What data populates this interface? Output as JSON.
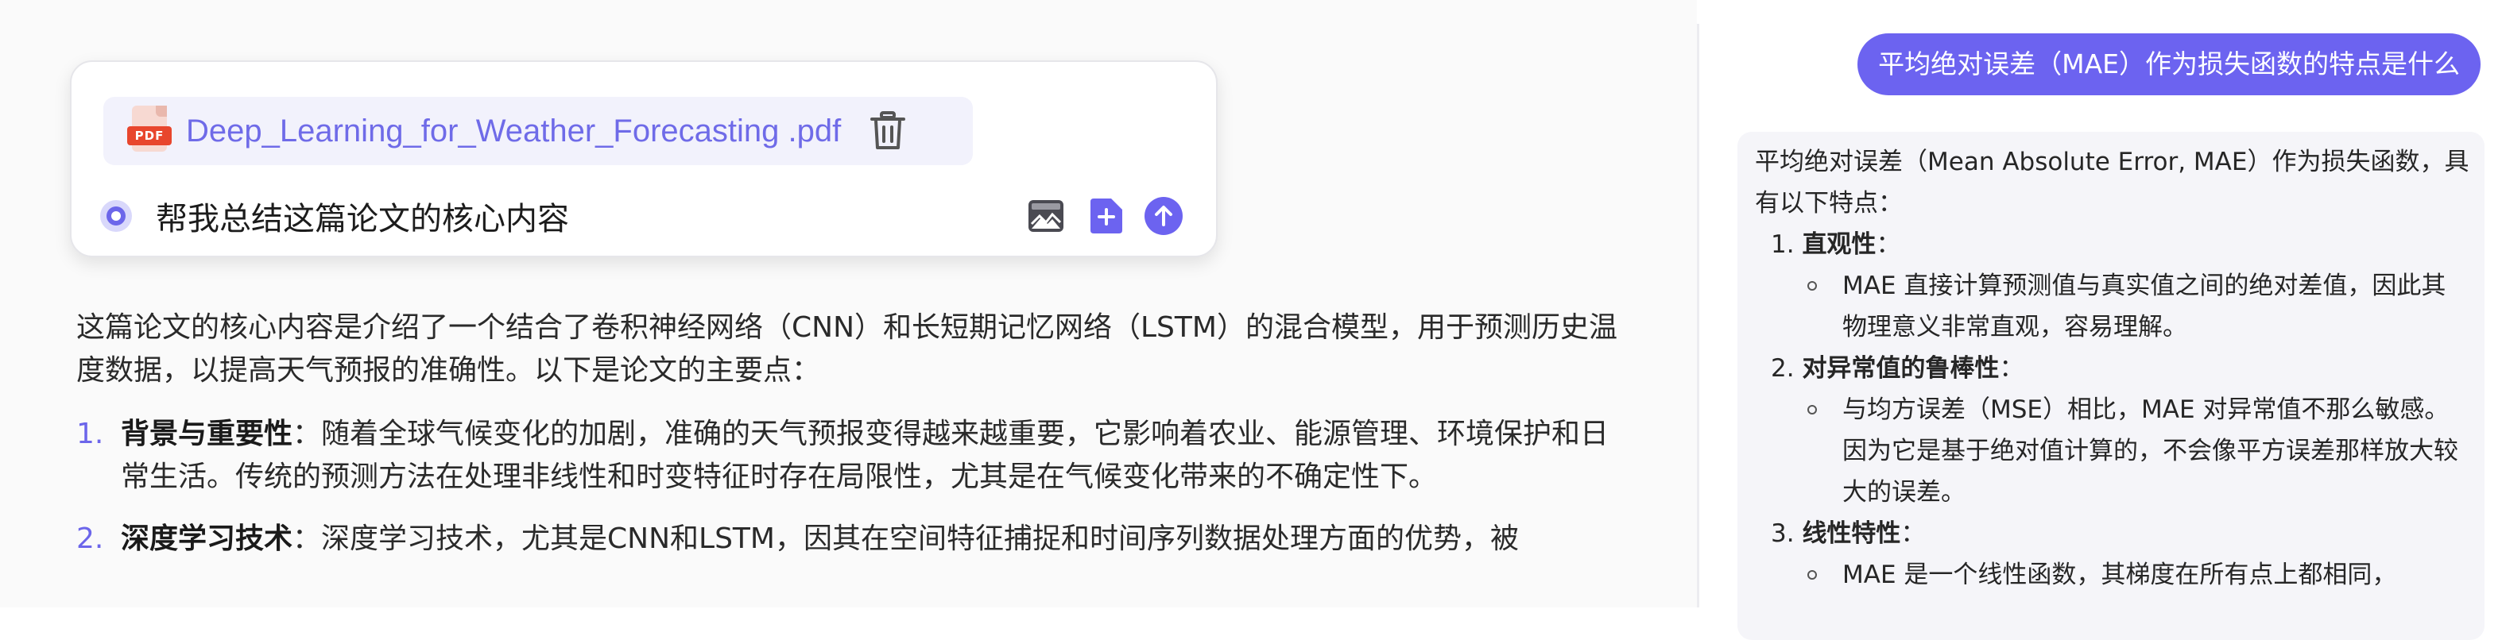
{
  "input_card": {
    "file_name": "Deep_Learning_for_Weather_Forecasting .pdf",
    "pdf_badge": "PDF",
    "prompt": "帮我总结这篇论文的核心内容"
  },
  "answer": {
    "intro": "这篇论文的核心内容是介绍了一个结合了卷积神经网络（CNN）和长短期记忆网络（LSTM）的混合模型，用于预测历史温度数据，以提高天气预报的准确性。以下是论文的主要点：",
    "points": [
      {
        "num": "1.",
        "title": "背景与重要性",
        "text": "：随着全球气候变化的加剧，准确的天气预报变得越来越重要，它影响着农业、能源管理、环境保护和日常生活。传统的预测方法在处理非线性和时变特征时存在局限性，尤其是在气候变化带来的不确定性下。"
      },
      {
        "num": "2.",
        "title": "深度学习技术",
        "text": "：深度学习技术，尤其是CNN和LSTM，因其在空间特征捕捉和时间序列数据处理方面的优势，被"
      }
    ]
  },
  "chat": {
    "user_message": "平均绝对误差（MAE）作为损失函数的特点是什么",
    "reply_intro": "平均绝对误差（Mean Absolute Error, MAE）作为损失函数，具有以下特点：",
    "points": [
      {
        "num": "1.",
        "title": "直观性",
        "colon": "：",
        "sub": "MAE 直接计算预测值与真实值之间的绝对差值，因此其物理意义非常直观，容易理解。"
      },
      {
        "num": "2.",
        "title": "对异常值的鲁棒性",
        "colon": "：",
        "sub": "与均方误差（MSE）相比，MAE 对异常值不那么敏感。因为它是基于绝对值计算的，不会像平方误差那样放大较大的误差。"
      },
      {
        "num": "3.",
        "title": "线性特性",
        "colon": "：",
        "sub": "MAE 是一个线性函数，其梯度在所有点上都相同，"
      }
    ]
  },
  "colors": {
    "accent": "#6c63f0",
    "file_text": "#6f6be8",
    "pdf_red": "#e8462d"
  },
  "icons": [
    "pdf-file-icon",
    "trash-icon",
    "radio-indicator-icon",
    "image-icon",
    "add-file-icon",
    "send-arrow-icon"
  ]
}
